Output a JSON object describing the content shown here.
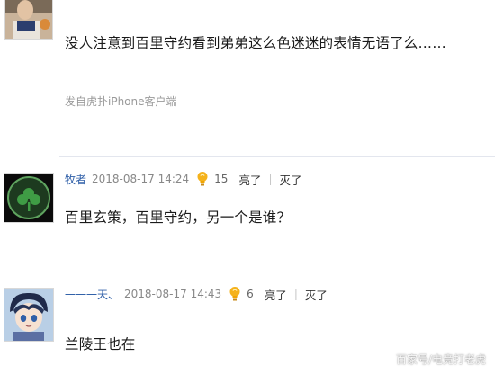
{
  "comments": [
    {
      "text": "没人注意到百里守约看到弟弟这么色迷迷的表情无语了么……",
      "source": "发自虎扑iPhone客户端"
    },
    {
      "user": "牧者",
      "time": "2018-08-17 14:24",
      "likes": "15",
      "light_label": "亮了",
      "dark_label": "灭了",
      "text": "百里玄策，百里守约，另一个是谁？"
    },
    {
      "user": "一一一天、",
      "time": "2018-08-17 14:43",
      "likes": "6",
      "light_label": "亮了",
      "dark_label": "灭了",
      "text": "兰陵王也在"
    }
  ],
  "watermark": "百家号/电竞打老虎",
  "colors": {
    "username": "#2f5fa8",
    "meta": "#888888",
    "separator": "#e3e6ee"
  },
  "icons": [
    "light-bulb-icon"
  ]
}
